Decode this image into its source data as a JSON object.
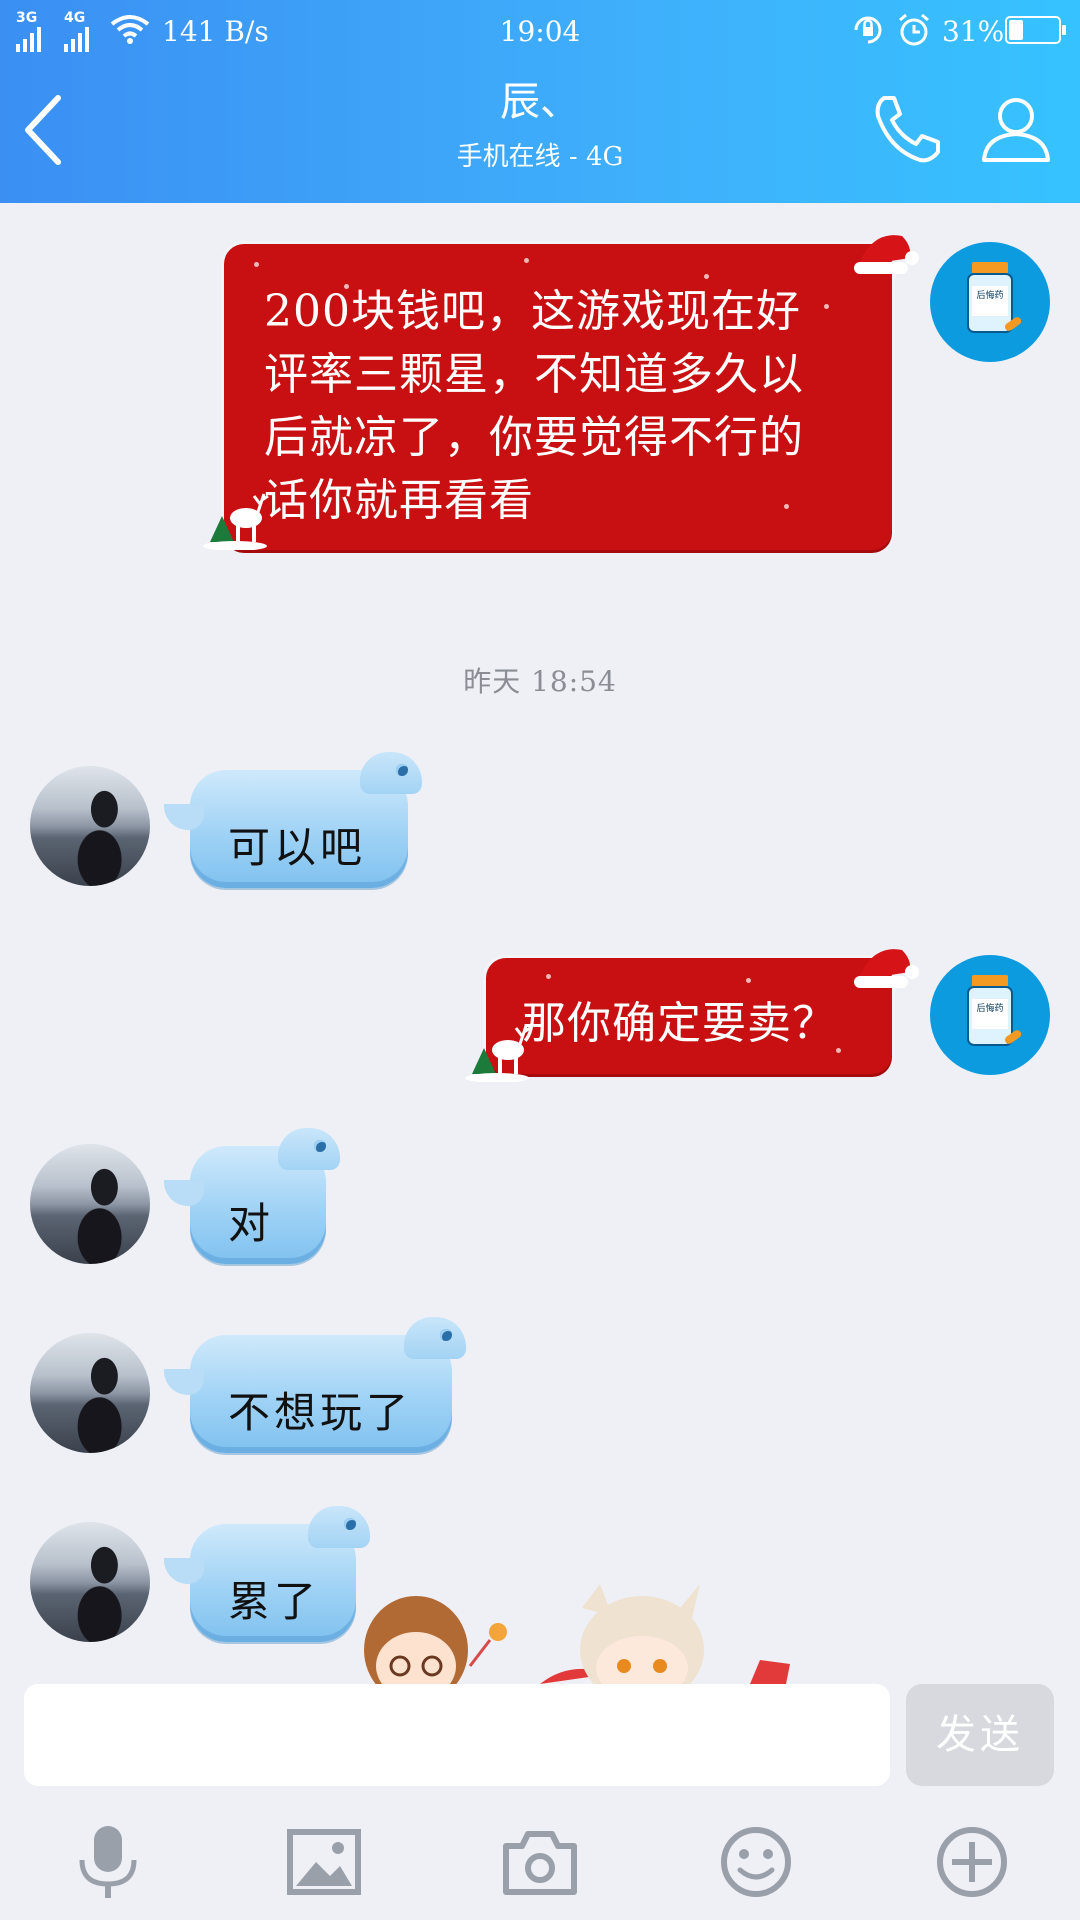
{
  "status_bar": {
    "signal1_label": "3G",
    "signal2_label": "4G",
    "net_speed": "141 B/s",
    "time": "19:04",
    "battery_percent": "31%",
    "battery_level": 0.31
  },
  "header": {
    "contact_name": "辰、",
    "contact_status": "手机在线 - 4G"
  },
  "messages": [
    {
      "side": "self",
      "text": "200块钱吧，这游戏现在好评率三颗星，不知道多久以后就凉了，你要觉得不行的话你就再看看",
      "lines": [
        "200块钱吧，这游戏现在好",
        "评率三颗星，不知道多久以",
        "后就凉了，你要觉得不行的",
        "话你就再看看"
      ]
    },
    {
      "side": "separator",
      "text": "昨天 18:54"
    },
    {
      "side": "contact",
      "text": "可以吧"
    },
    {
      "side": "self",
      "text": "那你确定要卖？"
    },
    {
      "side": "contact",
      "text": "对"
    },
    {
      "side": "contact",
      "text": "不想玩了"
    },
    {
      "side": "contact",
      "text": "累了"
    }
  ],
  "self_avatar_label": "后悔药",
  "input": {
    "placeholder": "",
    "send_label": "发送"
  },
  "toolbar": [
    "microphone-icon",
    "image-icon",
    "camera-icon",
    "emoji-icon",
    "plus-icon"
  ],
  "colors": {
    "header_start": "#3b8ff3",
    "header_end": "#36c2ff",
    "self_bubble": "#c81012",
    "contact_bubble": "#9fd2f5",
    "background": "#eef0f6"
  }
}
